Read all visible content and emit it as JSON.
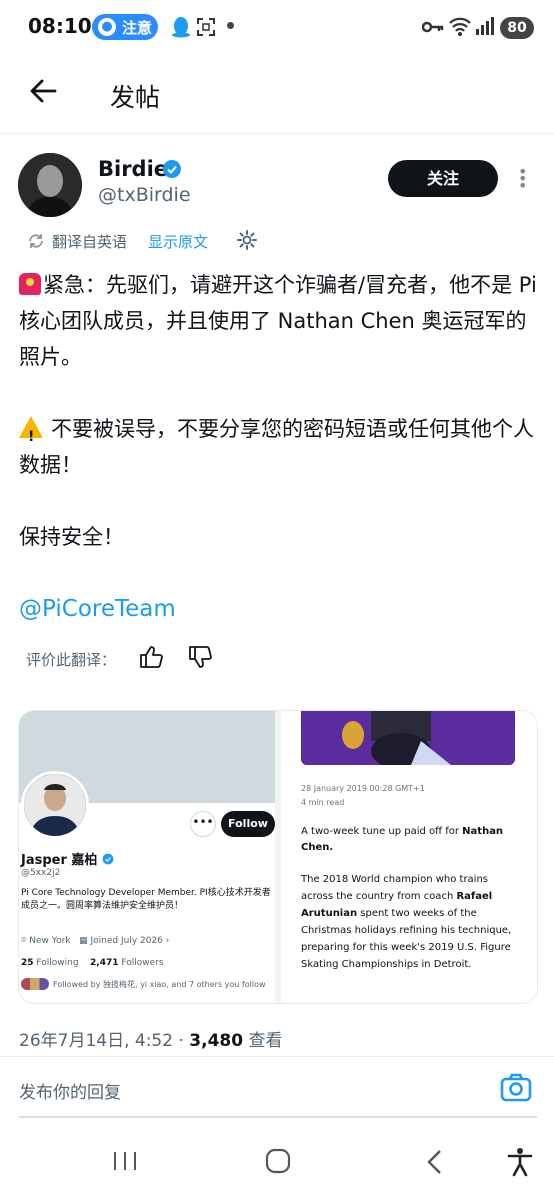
{
  "status_bar": {
    "time": "08:10",
    "notice_label": "注意",
    "battery": "80"
  },
  "header": {
    "title": "发帖"
  },
  "author": {
    "name": "Birdie",
    "handle": "@txBirdie",
    "follow_label": "关注"
  },
  "translation": {
    "label": "翻译自英语",
    "show_original": "显示原文",
    "rate_label": "评价此翻译："
  },
  "tweet": {
    "line1": "紧急：先驱们，请避开这个诈骗者/冒充者，他不是 Pi 核心团队成员，并且使用了 Nathan Chen 奥运冠军的照片。",
    "line2": "不要被误导，不要分享您的密码短语或任何其他个人数据！",
    "line3": "保持安全！",
    "mention": "@PiCoreTeam"
  },
  "media": {
    "profile": {
      "follow_label": "Follow",
      "name": "Jasper 嘉柏",
      "handle": "@5xx2j2",
      "bio": "Pi Core Technology Developer Member. PI核心技术开发者成员之一。圆周率算法维护安全维护员！",
      "location": "New York",
      "joined": "Joined July 2026",
      "following_count": "25",
      "following_label": "Following",
      "followers_count": "2,471",
      "followers_label": "Followers",
      "followed_by": "Followed by 独揽梅花, yi xiao, and 7 others you follow"
    },
    "article": {
      "date": "28 January 2019 00:28 GMT+1",
      "read_time": "4 min read",
      "p1_a": "A two-week tune up paid off for ",
      "p1_b": "Nathan Chen.",
      "p2_a": "The 2018 World champion who trains across the country from coach ",
      "p2_b": "Rafael Arutunian",
      "p2_c": " spent two weeks of the Christmas holidays refining his technique, preparing for this week's 2019 U.S. Figure Skating Championships in Detroit."
    }
  },
  "meta": {
    "datetime": "26年7月14日, 4:52 · ",
    "views_count": "3,480",
    "views_label": " 查看"
  },
  "reply": {
    "placeholder": "发布你的回复"
  },
  "colors": {
    "accent": "#1d9bf0",
    "text": "#0f1419",
    "muted": "#536471"
  }
}
